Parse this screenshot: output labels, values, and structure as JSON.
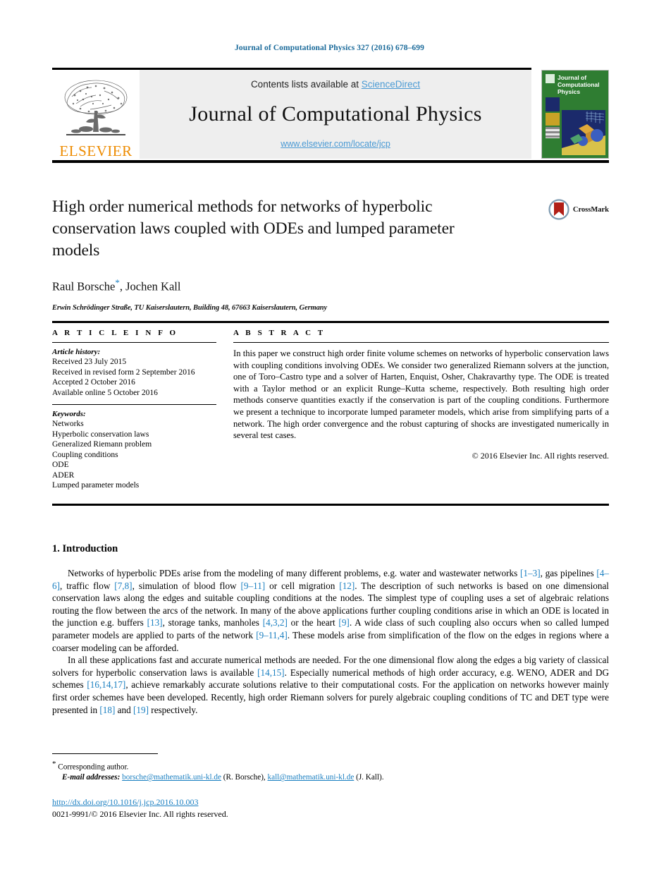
{
  "running_head": "Journal of Computational Physics 327 (2016) 678–699",
  "masthead": {
    "contents_prefix": "Contents lists available at ",
    "sciencedirect": "ScienceDirect",
    "journal_title": "Journal of Computational Physics",
    "journal_url": "www.elsevier.com/locate/jcp",
    "publisher_wordmark": "ELSEVIER",
    "cover_title_lines": [
      "Journal of",
      "Computational",
      "Physics"
    ],
    "colors": {
      "link": "#4a9ad4",
      "elsevier_orange": "#ED8B00",
      "cover_green": "#2f7d32",
      "band_gray": "#eeeeee"
    }
  },
  "article": {
    "title": "High order numerical methods for networks of hyperbolic conservation laws coupled with ODEs and lumped parameter models",
    "authors": "Raul Borsche",
    "authors_rest": ", Jochen Kall",
    "corresponding_marker": "*",
    "affiliation": "Erwin Schrödinger Straße, TU Kaiserslautern, Building 48, 67663 Kaiserslautern, Germany",
    "crossmark_label": "CrossMark"
  },
  "info": {
    "heading": "A R T I C L E   I N F O",
    "history_label": "Article history:",
    "history": [
      "Received 23 July 2015",
      "Received in revised form 2 September 2016",
      "Accepted 2 October 2016",
      "Available online 5 October 2016"
    ],
    "keywords_label": "Keywords:",
    "keywords": [
      "Networks",
      "Hyperbolic conservation laws",
      "Generalized Riemann problem",
      "Coupling conditions",
      "ODE",
      "ADER",
      "Lumped parameter models"
    ]
  },
  "abstract": {
    "heading": "A B S T R A C T",
    "text": "In this paper we construct high order finite volume schemes on networks of hyperbolic conservation laws with coupling conditions involving ODEs. We consider two generalized Riemann solvers at the junction, one of Toro–Castro type and a solver of Harten, Enquist, Osher, Chakravarthy type. The ODE is treated with a Taylor method or an explicit Runge–Kutta scheme, respectively. Both resulting high order methods conserve quantities exactly if the conservation is part of the coupling conditions. Furthermore we present a technique to incorporate lumped parameter models, which arise from simplifying parts of a network. The high order convergence and the robust capturing of shocks are investigated numerically in several test cases.",
    "copyright": "© 2016 Elsevier Inc. All rights reserved."
  },
  "introduction": {
    "section_number_title": "1. Introduction",
    "paragraph1_parts": [
      {
        "t": "Networks of hyperbolic PDEs arise from the modeling of many different problems, e.g. water and wastewater networks "
      },
      {
        "t": "[1–3]",
        "ref": true
      },
      {
        "t": ", gas pipelines "
      },
      {
        "t": "[4–6]",
        "ref": true
      },
      {
        "t": ", traffic flow "
      },
      {
        "t": "[7,8]",
        "ref": true
      },
      {
        "t": ", simulation of blood flow "
      },
      {
        "t": "[9–11]",
        "ref": true
      },
      {
        "t": " or cell migration "
      },
      {
        "t": "[12]",
        "ref": true
      },
      {
        "t": ". The description of such networks is based on one dimensional conservation laws along the edges and suitable coupling conditions at the nodes. The simplest type of coupling uses a set of algebraic relations routing the flow between the arcs of the network. In many of the above applications further coupling conditions arise in which an ODE is located in the junction e.g. buffers "
      },
      {
        "t": "[13]",
        "ref": true
      },
      {
        "t": ", storage tanks, manholes "
      },
      {
        "t": "[4,3,2]",
        "ref": true
      },
      {
        "t": " or the heart "
      },
      {
        "t": "[9]",
        "ref": true
      },
      {
        "t": ". A wide class of such coupling also occurs when so called lumped parameter models are applied to parts of the network "
      },
      {
        "t": "[9–11,4]",
        "ref": true
      },
      {
        "t": ". These models arise from simplification of the flow on the edges in regions where a coarser modeling can be afforded."
      }
    ],
    "paragraph2_parts": [
      {
        "t": "In all these applications fast and accurate numerical methods are needed. For the one dimensional flow along the edges a big variety of classical solvers for hyperbolic conservation laws is available "
      },
      {
        "t": "[14,15]",
        "ref": true
      },
      {
        "t": ". Especially numerical methods of high order accuracy, e.g. WENO, ADER and DG schemes "
      },
      {
        "t": "[16,14,17]",
        "ref": true
      },
      {
        "t": ", achieve remarkably accurate solutions relative to their computational costs. For the application on networks however mainly first order schemes have been developed. Recently, high order Riemann solvers for purely algebraic coupling conditions of TC and DET type were presented in "
      },
      {
        "t": "[18]",
        "ref": true
      },
      {
        "t": " and "
      },
      {
        "t": "[19]",
        "ref": true
      },
      {
        "t": " respectively."
      }
    ]
  },
  "footer": {
    "corresponding_marker": "*",
    "corresponding_author": "Corresponding author.",
    "email_label": "E-mail addresses:",
    "email1": "borsche@mathematik.uni-kl.de",
    "email1_owner": "(R. Borsche),",
    "email2": "kall@mathematik.uni-kl.de",
    "email2_owner": "(J. Kall).",
    "doi": "http://dx.doi.org/10.1016/j.jcp.2016.10.003",
    "issn_line": "0021-9991/© 2016 Elsevier Inc. All rights reserved."
  }
}
